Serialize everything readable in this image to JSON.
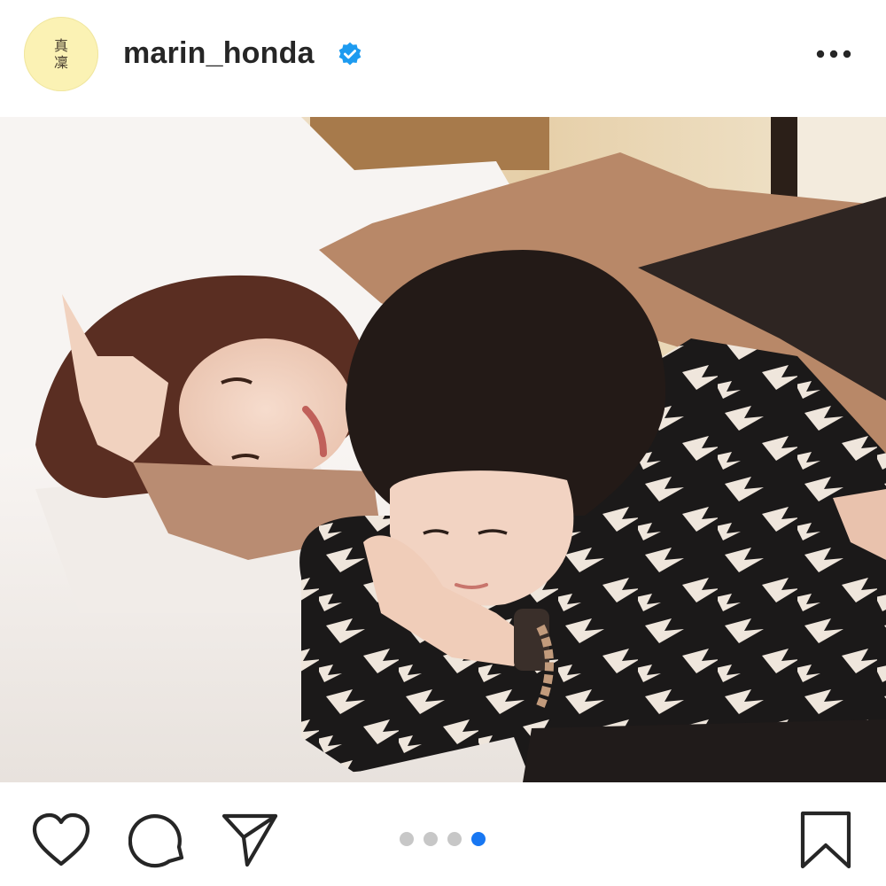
{
  "header": {
    "avatar_text": [
      "真",
      "凜"
    ],
    "username": "marin_honda",
    "verified": true,
    "more_icon": "more-horizontal-icon"
  },
  "post": {
    "image_description_icon": "photo",
    "carousel": {
      "total": 4,
      "active_index": 3,
      "inactive_color": "#c7c7c7",
      "active_color": "#1877f2"
    }
  },
  "actions": {
    "like_icon": "heart-icon",
    "comment_icon": "comment-icon",
    "share_icon": "paper-plane-icon",
    "save_icon": "bookmark-icon"
  },
  "colors": {
    "text": "#262626",
    "verified_blue": "#1d9bf0",
    "avatar_bg": "#fbf2b4"
  }
}
